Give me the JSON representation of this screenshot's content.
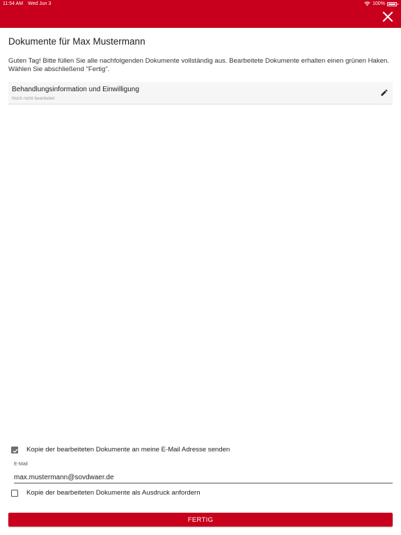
{
  "status_bar": {
    "time": "11:54 AM",
    "date": "Wed Jun 3",
    "battery": "100%"
  },
  "colors": {
    "accent": "#c8001e",
    "checkbox": "#6f6f6f"
  },
  "header": {
    "title": "Dokumente für Max Mustermann",
    "close_icon": "close-icon"
  },
  "intro": "Guten Tag! Bitte füllen Sie alle nachfolgenden Dokumente vollständig aus. Bearbeitete Dokumente erhalten einen grünen Haken. Wählen Sie abschließend \"Fertig\".",
  "documents": [
    {
      "title": "Behandlungsinformation und Einwilligung",
      "status": "Noch nicht bearbeitet",
      "icon": "pencil-icon"
    }
  ],
  "options": {
    "email_copy": {
      "label": "Kopie der bearbeiteten Dokumente an meine E-Mail Adresse senden",
      "checked": true
    },
    "email": {
      "label": "E-Mail",
      "value": "max.mustermann@sovdwaer.de"
    },
    "print_copy": {
      "label": "Kopie der bearbeiteten Dokumente als Ausdruck anfordern",
      "checked": false
    }
  },
  "footer": {
    "done_label": "FERTIG"
  }
}
